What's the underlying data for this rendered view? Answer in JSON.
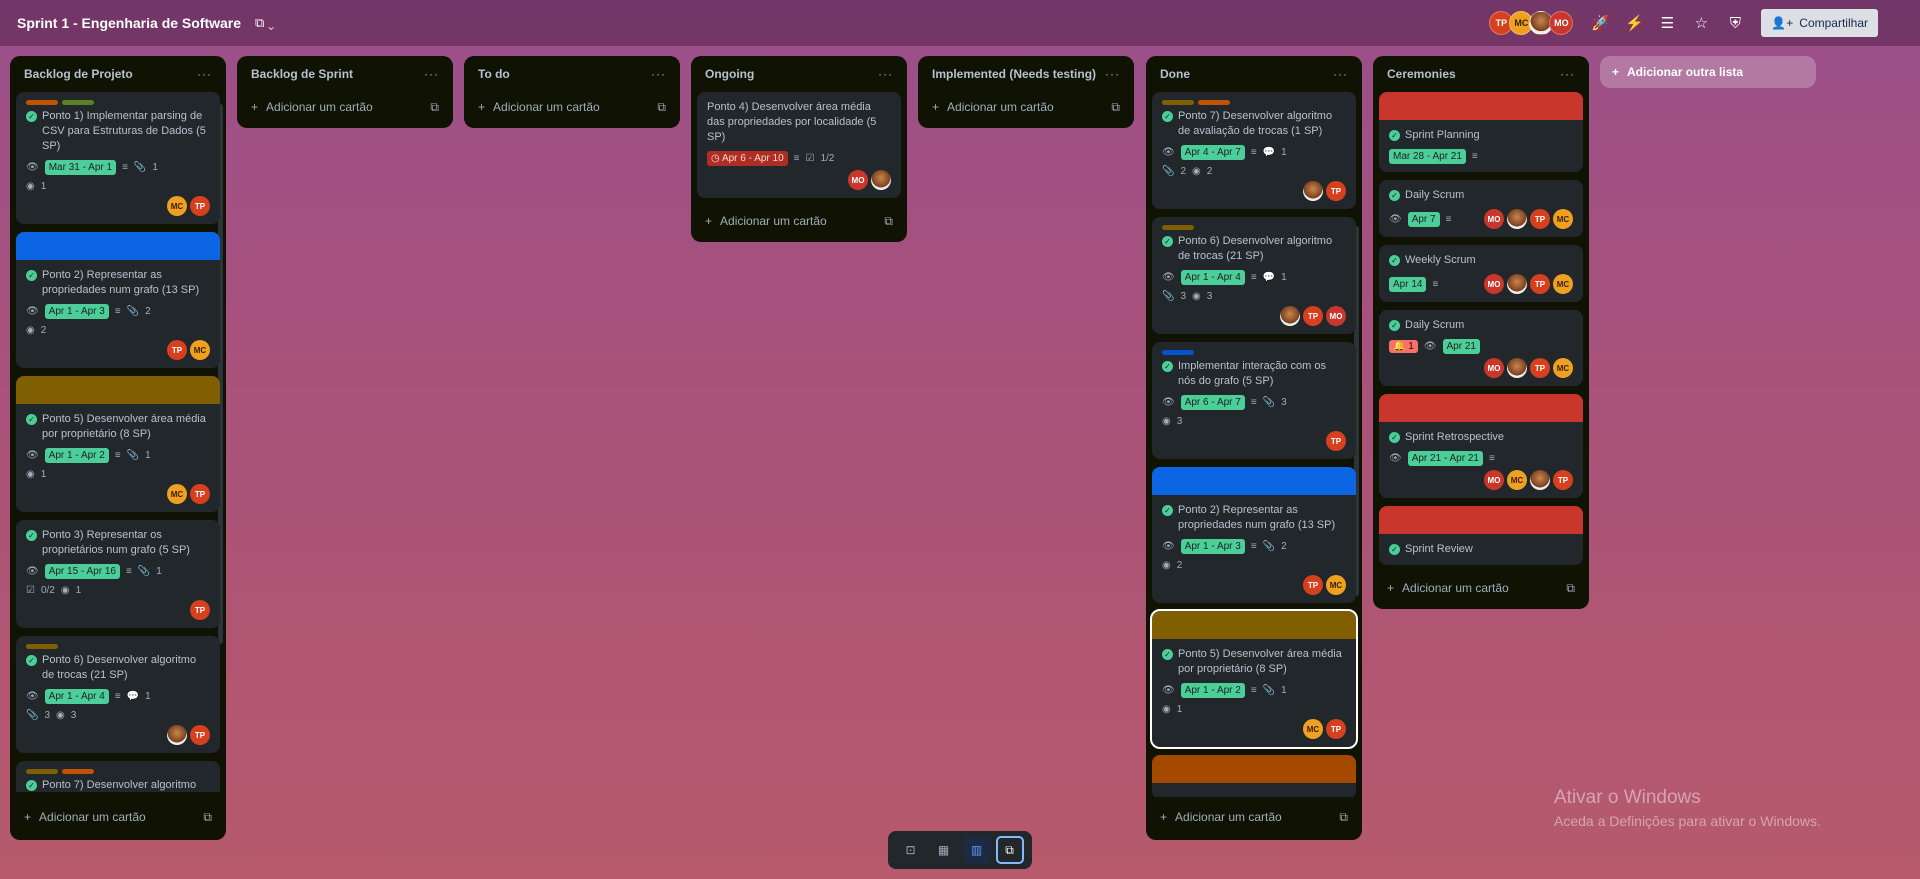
{
  "header": {
    "board_title": "Sprint 1 - Engenharia de Software",
    "share_label": "Compartilhar",
    "avatars": [
      "TP",
      "MC",
      "",
      "MO"
    ]
  },
  "add_list_label": "Adicionar outra lista",
  "add_card_label": "Adicionar um cartão",
  "lists": {
    "backlog_projeto": {
      "title": "Backlog de Projeto",
      "cards": [
        {
          "title": "Ponto 1) Implementar parsing de CSV para Estruturas de Dados (5 SP)",
          "date": "Mar 31 - Apr 1",
          "attachments": "1",
          "github": "1",
          "members": [
            "MC",
            "TP"
          ]
        },
        {
          "title": "Ponto 2) Representar as propriedades num grafo (13 SP)",
          "date": "Apr 1 - Apr 3",
          "attachments": "2",
          "github": "2",
          "members": [
            "TP",
            "MC"
          ]
        },
        {
          "title": "Ponto 5) Desenvolver área média por proprietário (8 SP)",
          "date": "Apr 1 - Apr 2",
          "attachments": "1",
          "github": "1",
          "members": [
            "MC",
            "TP"
          ]
        },
        {
          "title": "Ponto 3) Representar os proprietários num grafo (5 SP)",
          "date": "Apr 15 - Apr 16",
          "attachments": "1",
          "checklist": "0/2",
          "github": "1",
          "members": [
            "TP"
          ]
        },
        {
          "title": "Ponto 6) Desenvolver algoritmo de trocas (21 SP)",
          "date": "Apr 1 - Apr 4",
          "comments": "1",
          "attachments": "3",
          "github": "3",
          "members": [
            "",
            "TP"
          ]
        },
        {
          "title": "Ponto 7) Desenvolver algoritmo"
        }
      ]
    },
    "backlog_sprint": {
      "title": "Backlog de Sprint"
    },
    "todo": {
      "title": "To do"
    },
    "ongoing": {
      "title": "Ongoing",
      "cards": [
        {
          "title": "Ponto 4) Desenvolver área média das propriedades por localidade (5 SP)",
          "date": "Apr 6 - Apr 10",
          "checklist": "1/2",
          "members": [
            "MO",
            ""
          ]
        }
      ]
    },
    "implemented": {
      "title": "Implemented (Needs testing)"
    },
    "done": {
      "title": "Done",
      "cards": [
        {
          "title": "Ponto 7) Desenvolver algoritmo de avaliação de trocas (1 SP)",
          "date": "Apr 4 - Apr 7",
          "comments": "1",
          "attachments": "2",
          "github": "2",
          "members": [
            "",
            "TP"
          ]
        },
        {
          "title": "Ponto 6) Desenvolver algoritmo de trocas (21 SP)",
          "date": "Apr 1 - Apr 4",
          "comments": "1",
          "attachments": "3",
          "github": "3",
          "members": [
            "",
            "TP",
            "MO"
          ]
        },
        {
          "title": "Implementar interação com os nós do grafo (5 SP)",
          "date": "Apr 6 - Apr 7",
          "attachments": "3",
          "github": "3",
          "members": [
            "TP"
          ]
        },
        {
          "title": "Ponto 2) Representar as propriedades num grafo (13 SP)",
          "date": "Apr 1 - Apr 3",
          "attachments": "2",
          "github": "2",
          "members": [
            "TP",
            "MC"
          ]
        },
        {
          "title": "Ponto 5) Desenvolver área média por proprietário (8 SP)",
          "date": "Apr 1 - Apr 2",
          "attachments": "1",
          "github": "1",
          "members": [
            "MC",
            "TP"
          ]
        }
      ]
    },
    "ceremonies": {
      "title": "Ceremonies",
      "cards": [
        {
          "title": "Sprint Planning",
          "date": "Mar 28 - Apr 21"
        },
        {
          "title": "Daily Scrum",
          "date": "Apr 7",
          "members": [
            "MO",
            "",
            "TP",
            "MC"
          ]
        },
        {
          "title": "Weekly Scrum",
          "date": "Apr 14",
          "members": [
            "MO",
            "",
            "TP",
            "MC"
          ]
        },
        {
          "title": "Daily Scrum",
          "badge": "1",
          "date": "Apr 21",
          "members": [
            "MO",
            "",
            "TP",
            "MC"
          ]
        },
        {
          "title": "Sprint Retrospective",
          "date": "Apr 21 - Apr 21",
          "members": [
            "MO",
            "MC",
            "",
            "TP"
          ]
        },
        {
          "title": "Sprint Review"
        }
      ]
    }
  },
  "watermark": {
    "line1": "Ativar o Windows",
    "line2": "Aceda a Definições para ativar o Windows."
  },
  "colors": {
    "label_green": "#4bce97",
    "label_orange": "#c25100",
    "label_yellow": "#7f5f01",
    "label_lime": "#5b7f24",
    "label_blue": "#0055cc",
    "label_red": "#c9372c",
    "cover_blue": "#0c66e4",
    "cover_yellow": "#7f5f01",
    "cover_red": "#c9372c",
    "cover_orange": "#a54800"
  }
}
